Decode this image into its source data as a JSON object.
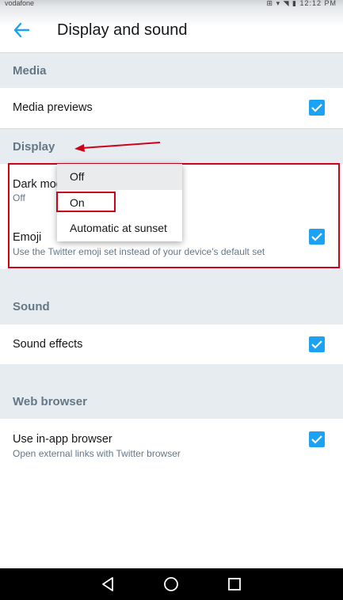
{
  "status_bar": {
    "carrier": "vodafone",
    "right_text": "⊞ ▾ ◥ ▮ 12:12 PM"
  },
  "header": {
    "title": "Display and sound",
    "back_icon": "arrow-left-icon"
  },
  "colors": {
    "accent": "#1da1f2",
    "section_bg": "#e6ecf0",
    "annotation": "#d0021b"
  },
  "sections": {
    "media": {
      "title": "Media",
      "items": [
        {
          "label": "Media previews",
          "checked": true
        }
      ]
    },
    "display": {
      "title": "Display",
      "dark_mode": {
        "label": "Dark mode",
        "value": "Off"
      },
      "emoji": {
        "label": "Emoji",
        "description": "Use the Twitter emoji set instead of your device's default set",
        "checked": true
      }
    },
    "sound": {
      "title": "Sound",
      "items": [
        {
          "label": "Sound effects",
          "checked": true
        }
      ]
    },
    "web_browser": {
      "title": "Web browser",
      "items": [
        {
          "label": "Use in-app browser",
          "description": "Open external links with Twitter browser",
          "checked": true
        }
      ]
    }
  },
  "dark_mode_menu": {
    "options": [
      "Off",
      "On",
      "Automatic at sunset"
    ],
    "highlighted": "Off",
    "annotated": "On"
  },
  "nav_bar": {
    "icons": [
      "back-triangle-icon",
      "home-circle-icon",
      "recents-square-icon"
    ]
  }
}
